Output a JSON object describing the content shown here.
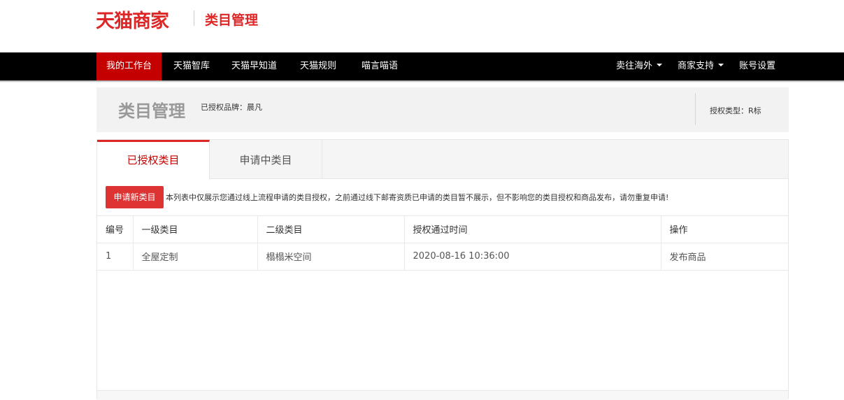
{
  "brand": {
    "logo_text": "天猫商家",
    "page_name": "类目管理"
  },
  "nav": {
    "left": [
      "我的工作台",
      "天猫智库",
      "天猫早知道",
      "天猫规则",
      "喵言喵语"
    ],
    "right": [
      {
        "label": "卖往海外",
        "dropdown": true
      },
      {
        "label": "商家支持",
        "dropdown": true
      },
      {
        "label": "账号设置",
        "dropdown": false
      }
    ],
    "active_index": 0,
    "active_color": "#c40000"
  },
  "header": {
    "title": "类目管理",
    "authorized_brand": "已授权品牌：晨凡",
    "auth_type": "授权类型：R标"
  },
  "tabs": [
    {
      "label": "已授权类目",
      "active": true
    },
    {
      "label": "申请中类目",
      "active": false
    }
  ],
  "actions": {
    "apply_button": "申请新类目",
    "notice": "本列表中仅展示您通过线上流程申请的类目授权，之前通过线下邮寄资质已申请的类目暂不展示，但不影响您的类目授权和商品发布，请勿重复申请!"
  },
  "table": {
    "columns": [
      "编号",
      "一级类目",
      "二级类目",
      "授权通过时间",
      "操作"
    ],
    "rows": [
      {
        "id": "1",
        "level1": "全屋定制",
        "level2": "榻榻米空间",
        "time": "2020-08-16 10:36:00",
        "action": "发布商品"
      }
    ]
  },
  "colors": {
    "accent": "#dd2727",
    "link": "#2b7fc4",
    "nav_bg": "#000000"
  }
}
